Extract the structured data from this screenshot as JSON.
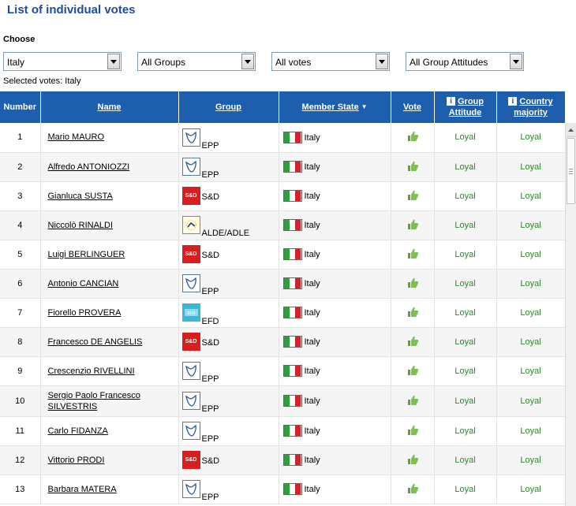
{
  "header": {
    "title": "List of individual votes"
  },
  "filters": {
    "choose_label": "Choose",
    "country": "Italy",
    "group": "All Groups",
    "votes": "All votes",
    "attitudes": "All Group Attitudes",
    "selected_text": "Selected votes: Italy"
  },
  "table": {
    "columns": {
      "number": "Number",
      "name": "Name",
      "group": "Group",
      "member_state": "Member State",
      "vote": "Vote",
      "group_attitude": "Group Attitude",
      "country_majority": "Country majority"
    },
    "rows": [
      {
        "number": "1",
        "name": "Mario MAURO",
        "group": "EPP",
        "logo": "epp",
        "state": "Italy",
        "vote": "thumb-up",
        "attitude": "Loyal",
        "majority": "Loyal"
      },
      {
        "number": "2",
        "name": "Alfredo ANTONIOZZI",
        "group": "EPP",
        "logo": "epp",
        "state": "Italy",
        "vote": "thumb-up",
        "attitude": "Loyal",
        "majority": "Loyal"
      },
      {
        "number": "3",
        "name": "Gianluca SUSTA",
        "group": "S&D",
        "logo": "sd",
        "state": "Italy",
        "vote": "thumb-up",
        "attitude": "Loyal",
        "majority": "Loyal"
      },
      {
        "number": "4",
        "name": "Niccolò RINALDI",
        "group": "ALDE/ADLE",
        "logo": "alde",
        "state": "Italy",
        "vote": "thumb-up",
        "attitude": "Loyal",
        "majority": "Loyal"
      },
      {
        "number": "5",
        "name": "Luigi BERLINGUER",
        "group": "S&D",
        "logo": "sd",
        "state": "Italy",
        "vote": "thumb-up",
        "attitude": "Loyal",
        "majority": "Loyal"
      },
      {
        "number": "6",
        "name": "Antonio CANCIAN",
        "group": "EPP",
        "logo": "epp",
        "state": "Italy",
        "vote": "thumb-up",
        "attitude": "Loyal",
        "majority": "Loyal"
      },
      {
        "number": "7",
        "name": "Fiorello PROVERA",
        "group": "EFD",
        "logo": "efd",
        "state": "Italy",
        "vote": "thumb-up",
        "attitude": "Loyal",
        "majority": "Loyal"
      },
      {
        "number": "8",
        "name": "Francesco DE ANGELIS",
        "group": "S&D",
        "logo": "sd",
        "state": "Italy",
        "vote": "thumb-up",
        "attitude": "Loyal",
        "majority": "Loyal"
      },
      {
        "number": "9",
        "name": "Crescenzio RIVELLINI",
        "group": "EPP",
        "logo": "epp",
        "state": "Italy",
        "vote": "thumb-up",
        "attitude": "Loyal",
        "majority": "Loyal"
      },
      {
        "number": "10",
        "name": "Sergio Paolo Francesco SILVESTRIS",
        "group": "EPP",
        "logo": "epp",
        "state": "Italy",
        "vote": "thumb-up",
        "attitude": "Loyal",
        "majority": "Loyal"
      },
      {
        "number": "11",
        "name": "Carlo FIDANZA",
        "group": "EPP",
        "logo": "epp",
        "state": "Italy",
        "vote": "thumb-up",
        "attitude": "Loyal",
        "majority": "Loyal"
      },
      {
        "number": "12",
        "name": "Vittorio PRODI",
        "group": "S&D",
        "logo": "sd",
        "state": "Italy",
        "vote": "thumb-up",
        "attitude": "Loyal",
        "majority": "Loyal"
      },
      {
        "number": "13",
        "name": "Barbara MATERA",
        "group": "EPP",
        "logo": "epp",
        "state": "Italy",
        "vote": "thumb-up",
        "attitude": "Loyal",
        "majority": "Loyal"
      }
    ]
  },
  "colors": {
    "title": "#1c4da0",
    "header_bg": "#1d5fad",
    "loyal_text": "#2a8a2a",
    "thumb_green": "#7cc24a"
  }
}
